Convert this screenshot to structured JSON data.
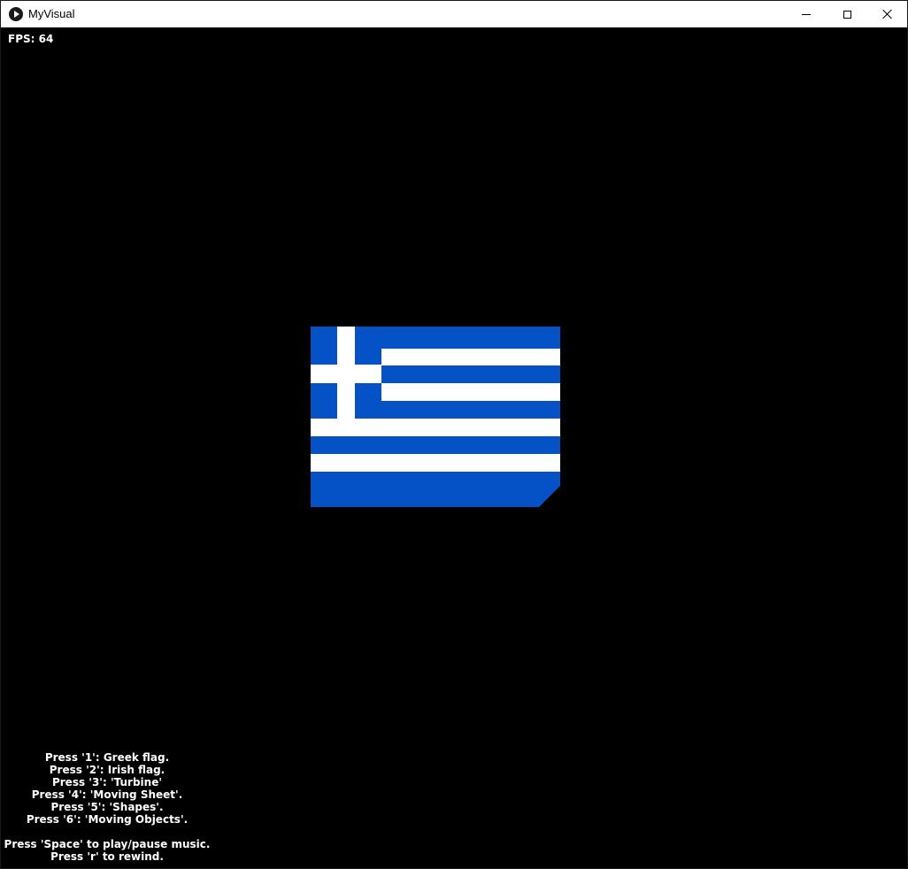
{
  "window": {
    "title": "MyVisual",
    "app_icon": "play-circle-icon",
    "controls": {
      "minimize_icon": "minimize-icon",
      "maximize_icon": "maximize-icon",
      "close_icon": "close-icon"
    }
  },
  "canvas": {
    "background": "#000000",
    "fps_text": "FPS: 64"
  },
  "flag": {
    "name": "Greek flag",
    "blue": "#0552C7",
    "white": "#FFFFFF"
  },
  "help": {
    "keys": [
      "Press '1': Greek flag.",
      "Press '2': Irish flag.",
      "Press '3': 'Turbine'",
      "Press '4': 'Moving Sheet'.",
      "Press '5': 'Shapes'.",
      "Press '6': 'Moving Objects'."
    ],
    "music": [
      "Press 'Space' to play/pause music.",
      "Press 'r' to rewind."
    ]
  }
}
